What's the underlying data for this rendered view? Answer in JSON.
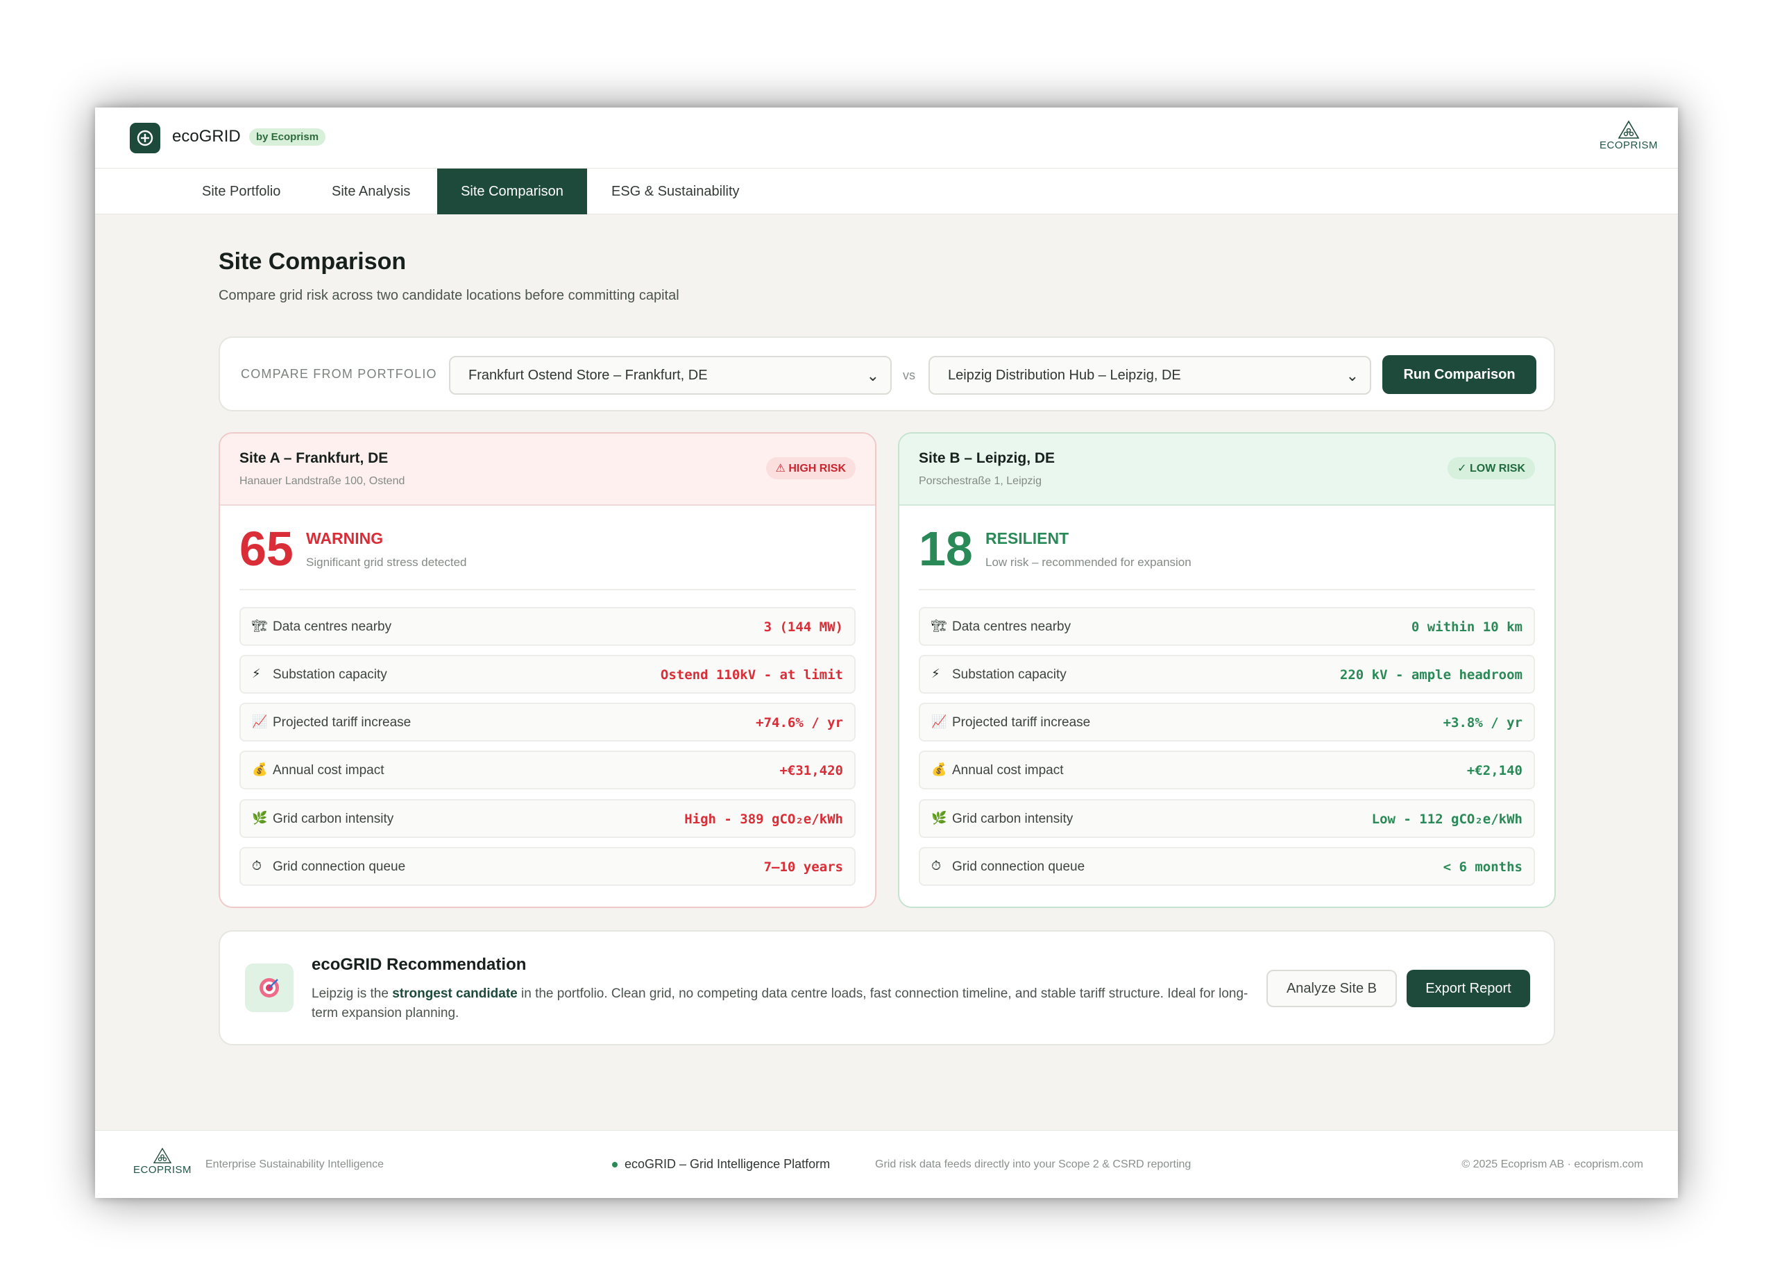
{
  "header": {
    "app_name": "ecoGRID",
    "by_badge": "by Ecoprism",
    "brand": "ECOPRISM"
  },
  "tabs": [
    {
      "label": "Site Portfolio",
      "active": false
    },
    {
      "label": "Site Analysis",
      "active": false
    },
    {
      "label": "Site Comparison",
      "active": true
    },
    {
      "label": "ESG & Sustainability",
      "active": false
    }
  ],
  "page": {
    "title": "Site Comparison",
    "subtitle": "Compare grid risk across two candidate locations before committing capital"
  },
  "compare": {
    "label": "COMPARE FROM PORTFOLIO",
    "site_a_selected": "Frankfurt Ostend Store – Frankfurt, DE",
    "vs": "vs",
    "site_b_selected": "Leipzig Distribution Hub – Leipzig, DE",
    "run_label": "Run Comparison"
  },
  "site_a": {
    "title": "Site A – Frankfurt, DE",
    "address": "Hanauer Landstraße 100, Ostend",
    "badge": "⚠ HIGH RISK",
    "score": "65",
    "status": "WARNING",
    "status_sub": "Significant grid stress detected",
    "metrics": [
      {
        "icon": "🏗",
        "label": "Data centres nearby",
        "value": "3 (144 MW)"
      },
      {
        "icon": "⚡",
        "label": "Substation capacity",
        "value": "Ostend 110kV - at limit"
      },
      {
        "icon": "📈",
        "label": "Projected tariff increase",
        "value": "+74.6% / yr"
      },
      {
        "icon": "💰",
        "label": "Annual cost impact",
        "value": "+€31,420"
      },
      {
        "icon": "🌿",
        "label": "Grid carbon intensity",
        "value": "High - 389 gCO₂e/kWh"
      },
      {
        "icon": "⏱",
        "label": "Grid connection queue",
        "value": "7–10 years"
      }
    ]
  },
  "site_b": {
    "title": "Site B – Leipzig, DE",
    "address": "Porschestraße 1, Leipzig",
    "badge": "✓ LOW RISK",
    "score": "18",
    "status": "RESILIENT",
    "status_sub": "Low risk – recommended for expansion",
    "metrics": [
      {
        "icon": "🏗",
        "label": "Data centres nearby",
        "value": "0 within 10 km"
      },
      {
        "icon": "⚡",
        "label": "Substation capacity",
        "value": "220 kV - ample headroom"
      },
      {
        "icon": "📈",
        "label": "Projected tariff increase",
        "value": "+3.8% / yr"
      },
      {
        "icon": "💰",
        "label": "Annual cost impact",
        "value": "+€2,140"
      },
      {
        "icon": "🌿",
        "label": "Grid carbon intensity",
        "value": "Low - 112 gCO₂e/kWh"
      },
      {
        "icon": "⏱",
        "label": "Grid connection queue",
        "value": "< 6 months"
      }
    ]
  },
  "recommendation": {
    "title": "ecoGRID Recommendation",
    "body_pre": "Leipzig is the ",
    "body_strong": "strongest candidate",
    "body_post": " in the portfolio. Clean grid, no competing data centre loads, fast connection timeline, and stable tariff structure. Ideal for long-term expansion planning.",
    "analyze_label": "Analyze Site B",
    "export_label": "Export Report"
  },
  "footer": {
    "brand": "ECOPRISM",
    "tagline": "Enterprise Sustainability Intelligence",
    "platform": "ecoGRID – Grid Intelligence Platform",
    "note": "Grid risk data feeds directly into your Scope 2 & CSRD reporting",
    "copyright": "© 2025 Ecoprism AB · ecoprism.com"
  },
  "colors": {
    "brand_green": "#1d4a3a",
    "risk_red": "#d92d37",
    "safe_green": "#2a8a57"
  }
}
